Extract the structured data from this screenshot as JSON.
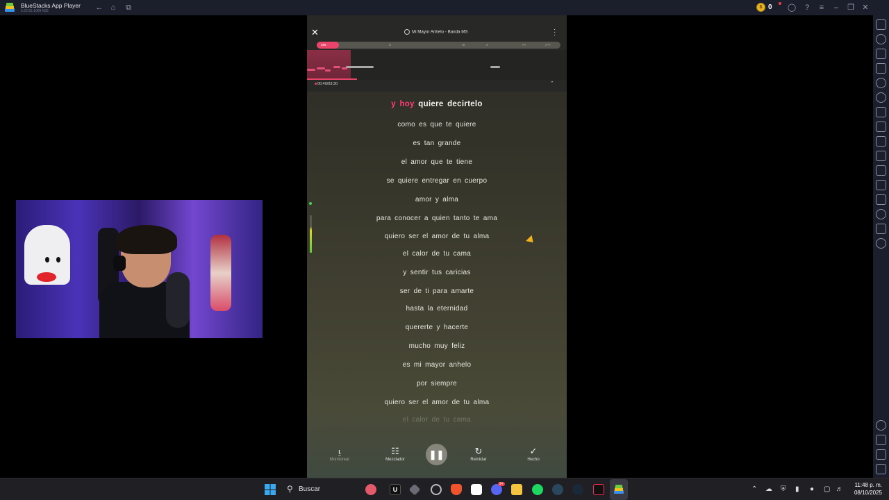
{
  "window": {
    "app_title": "BlueStacks App Player",
    "app_version": "5.22.55.1009 N32",
    "coins": "0"
  },
  "player": {
    "song_title": "Mi Mayor Anhelo - Banda MS",
    "score": "286",
    "score_fraction": 0.09,
    "grades": [
      "C",
      "B",
      "A",
      "A+",
      "A++"
    ],
    "time": "00:40/03:30",
    "progress_fraction": 0.19
  },
  "lyrics": {
    "current_sung": "y hoy",
    "current_rest": " quiere decirtelo",
    "lines": [
      "como es que te quiere",
      "es tan grande",
      "el amor que te tiene",
      "se quiere entregar en cuerpo",
      "amor y alma",
      "para conocer a quien tanto te ama",
      "quiero ser el amor de tu alma",
      "el calor de tu cama",
      "y sentir tus caricias",
      "ser de ti para amarte",
      "hasta la eternidad",
      "quererte y hacerte",
      "mucho muy feliz",
      "es mi mayor anhelo",
      "por siempre",
      "quiero ser el amor de tu alma",
      "el calor de tu cama"
    ]
  },
  "controls": {
    "monitor": "Monitorear",
    "mixer": "Mezclador",
    "restart": "Reiniciar",
    "done": "Hecho"
  },
  "taskbar": {
    "search_label": "Buscar",
    "time": "11:48 p. m.",
    "date": "08/10/2025",
    "discord_badge": "9+"
  },
  "colors": {
    "accent_pink": "#ff3d77",
    "titlebar_bg": "#1b1e2b",
    "taskbar_bg": "#1f1f24"
  }
}
